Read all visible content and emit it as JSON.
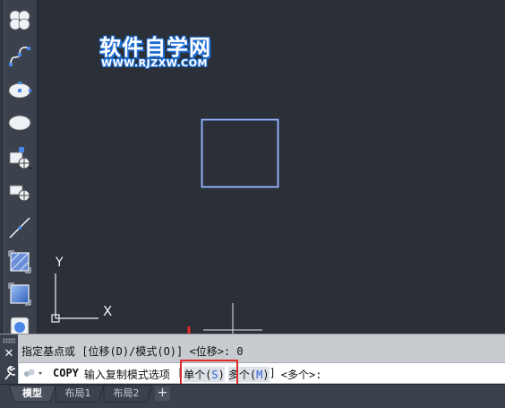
{
  "watermark": {
    "title": "软件自学网",
    "url": "WWW.RJZXW.COM"
  },
  "canvas": {
    "ucs_x_label": "X",
    "ucs_y_label": "Y"
  },
  "command": {
    "history": "指定基点或 [位移(D)/模式(O)] <位移>: 0",
    "command_name": "COPY",
    "prompt": "输入复制模式选项",
    "bracket_open": "[",
    "option_single_label": "单个(",
    "option_single_key": "S",
    "option_single_close": ")",
    "option_multiple_label": "多个(",
    "option_multiple_key": "M",
    "option_multiple_close": ")",
    "bracket_close": "]",
    "default_text": "<多个>:"
  },
  "tabs": [
    {
      "label": "模型"
    },
    {
      "label": "布局1"
    },
    {
      "label": "布局2"
    }
  ],
  "tab_add_label": "+",
  "colors": {
    "canvas_bg": "#2a2f38",
    "rectangle_stroke": "#6e96f0",
    "highlight": "#e12a2a",
    "option_key": "#2b5fd9"
  }
}
